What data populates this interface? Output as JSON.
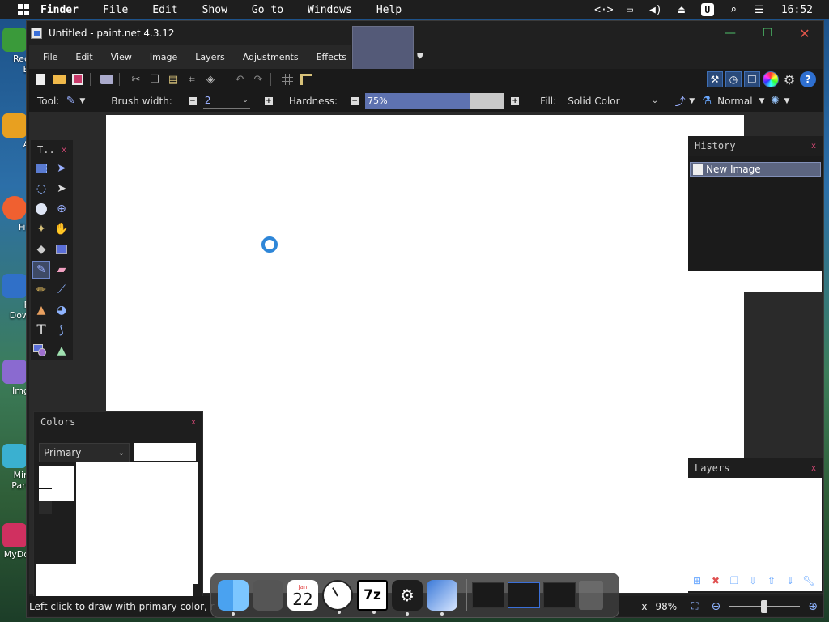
{
  "menubar": {
    "items": [
      "Finder",
      "File",
      "Edit",
      "Show",
      "Go to",
      "Windows",
      "Help"
    ],
    "tray_u": "U",
    "clock": "16:52"
  },
  "desktop_icons": [
    {
      "label": "Rec",
      "label2": "B",
      "color": "#3a9a3a"
    },
    {
      "label": "A",
      "color": "#e8a020"
    },
    {
      "label": "Fir",
      "color": "#f06030"
    },
    {
      "label": "F",
      "label2": "Dow",
      "color": "#3070c8"
    },
    {
      "label": "Img",
      "color": "#8a6ad0"
    },
    {
      "label": "Min",
      "label2": "Part",
      "color": "#3ab0d0"
    },
    {
      "label": "MyDo",
      "color": "#d03060"
    }
  ],
  "window": {
    "title": "Untitled - paint.net 4.3.12",
    "menus": [
      "File",
      "Edit",
      "View",
      "Image",
      "Layers",
      "Adjustments",
      "Effects"
    ]
  },
  "toolbar2": {
    "tool_label": "Tool:",
    "brush_width_label": "Brush width:",
    "brush_width_value": "2",
    "hardness_label": "Hardness:",
    "hardness_value": "75%",
    "hardness_fraction": 0.75,
    "fill_label": "Fill:",
    "fill_value": "Solid Color",
    "blend_value": "Normal"
  },
  "tools_panel": {
    "title": "T..",
    "close": "x"
  },
  "history_panel": {
    "title": "History",
    "close": "x",
    "items": [
      "New Image"
    ]
  },
  "colors_panel": {
    "title": "Colors",
    "close": "x",
    "selector": "Primary"
  },
  "layers_panel": {
    "title": "Layers",
    "close": "x"
  },
  "status": {
    "text": "Left click to draw with primary color, right c",
    "partial": "x",
    "zoom": "98%",
    "zoom_fraction": 0.5
  },
  "dock": {
    "calendar_month": "Jan",
    "calendar_day": "22",
    "sevenzip": "7z"
  },
  "colors": {
    "accent": "#5e72b0",
    "canvas": "#ffffff",
    "close_red": "#e2564a"
  }
}
